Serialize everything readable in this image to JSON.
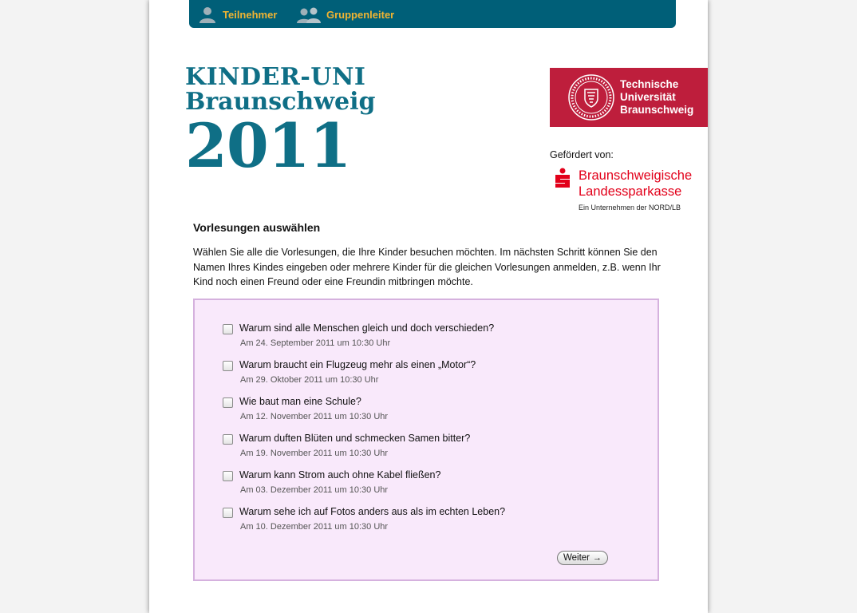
{
  "nav": {
    "items": [
      {
        "label": "Teilnehmer",
        "icon": "person-icon"
      },
      {
        "label": "Gruppenleiter",
        "icon": "group-icon"
      }
    ],
    "background": "#005f78",
    "label_color": "#f0b432"
  },
  "kinder_logo": {
    "line1": "KINDER-UNI",
    "line2": "Braunschweig",
    "line3": "2011",
    "color": "#0f6f86"
  },
  "tu_logo": {
    "line1": "Technische",
    "line2": "Universität",
    "line3": "Braunschweig",
    "background": "#be1e3c"
  },
  "sponsor": {
    "label": "Gefördert von:",
    "name_line1": "Braunschweigische",
    "name_line2": "Landessparkasse",
    "subline": "Ein Unternehmen der NORD/LB",
    "color": "#e2001a"
  },
  "main": {
    "heading": "Vorlesungen auswählen",
    "intro": "Wählen Sie alle die Vorlesungen, die Ihre Kinder besuchen möchten. Im nächsten Schritt können Sie den Namen Ihres Kindes eingeben oder mehrere Kinder für die gleichen Vorlesungen anmelden, z.B. wenn Ihr Kind noch einen Freund oder eine Freundin mitbringen möchte.",
    "lectures": [
      {
        "title": "Warum sind alle Menschen gleich und doch verschieden?",
        "date": "Am 24. September 2011 um 10:30 Uhr",
        "checked": false
      },
      {
        "title": "Warum braucht ein Flugzeug mehr als einen „Motor“?",
        "date": "Am 29. Oktober 2011 um 10:30 Uhr",
        "checked": false
      },
      {
        "title": "Wie baut man eine Schule?",
        "date": "Am 12. November 2011 um 10:30 Uhr",
        "checked": false
      },
      {
        "title": "Warum duften Blüten und schmecken Samen bitter?",
        "date": "Am 19. November 2011 um 10:30 Uhr",
        "checked": false
      },
      {
        "title": "Warum kann Strom auch ohne Kabel fließen?",
        "date": "Am 03. Dezember 2011 um 10:30 Uhr",
        "checked": false
      },
      {
        "title": "Warum sehe ich auf Fotos anders aus als im echten Leben?",
        "date": "Am 10. Dezember 2011 um 10:30 Uhr",
        "checked": false
      }
    ],
    "box_background": "#f9e9fb",
    "box_border": "#d5b1de",
    "next_button": {
      "label": "Weiter",
      "icon": "arrow-right-icon",
      "arrow": "→"
    }
  }
}
